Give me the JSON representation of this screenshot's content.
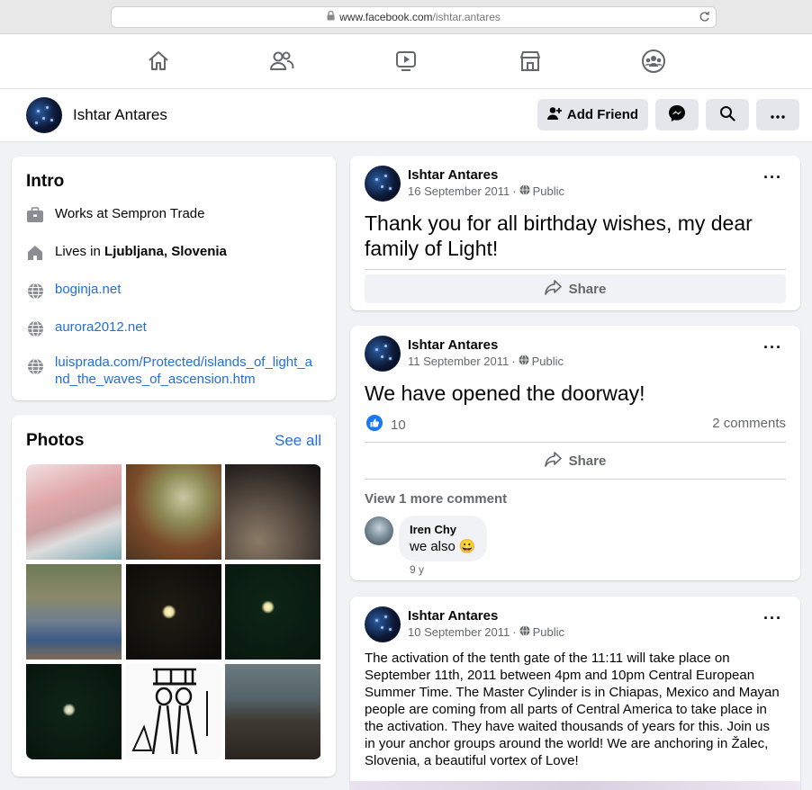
{
  "browser": {
    "url_domain": "www.facebook.com",
    "url_path": "/ishtar.antares"
  },
  "nav": {
    "icons": [
      "home-icon",
      "friends-icon",
      "watch-icon",
      "marketplace-icon",
      "groups-icon"
    ]
  },
  "profile": {
    "name": "Ishtar Antares",
    "add_friend_label": "Add Friend"
  },
  "intro": {
    "title": "Intro",
    "work_prefix": "Works at ",
    "work_place": "Sempron Trade",
    "lives_prefix": "Lives in ",
    "lives_place": "Ljubljana, Slovenia",
    "links": [
      "boginja.net",
      "aurora2012.net",
      "luisprada.com/Protected/islands_of_light_a",
      "nd_the_waves_of_ascension.htm"
    ]
  },
  "photos": {
    "title": "Photos",
    "see_all": "See all",
    "items": [
      "pink-crystals-photo",
      "painting-women-photo",
      "planet-surface-photo",
      "couple-under-tree-photo",
      "eclipse-photo-1",
      "eclipse-photo-2",
      "crescent-moon-photo",
      "egyptian-drawing-photo",
      "temple-scene-photo"
    ]
  },
  "posts": [
    {
      "author": "Ishtar Antares",
      "date": "16 September 2011",
      "privacy": "Public",
      "text_line1": "Thank you for all birthday wishes, my dear",
      "text_line2": "family of Light!",
      "share_label": "Share"
    },
    {
      "author": "Ishtar Antares",
      "date": "11 September 2011",
      "privacy": "Public",
      "text": "We have opened the doorway!",
      "likes": "10",
      "comments": "2 comments",
      "share_label": "Share",
      "view_more": "View 1 more comment",
      "comment": {
        "author": "Iren Chy",
        "text": "we also",
        "emoji": "😀",
        "age": "9 y"
      }
    },
    {
      "author": "Ishtar Antares",
      "date": "10 September 2011",
      "privacy": "Public",
      "lines": [
        "The activation of the tenth gate of the 11:11 will take place on",
        "September 11th, 2011 between 4pm and 10pm Central European",
        "Summer Time. The Master Cylinder is in Chiapas, Mexico and Mayan",
        "people are coming from all parts of Central America to take place in",
        "the activation. They have waited thousands of years for this. Join us",
        "in your anchor groups around the world! We are anchoring in Žalec,",
        "Slovenia, a beautiful vortex of Love!"
      ]
    }
  ],
  "colors": {
    "link": "#216fdb",
    "like": "#1877f2",
    "background": "#f0f2f5"
  }
}
